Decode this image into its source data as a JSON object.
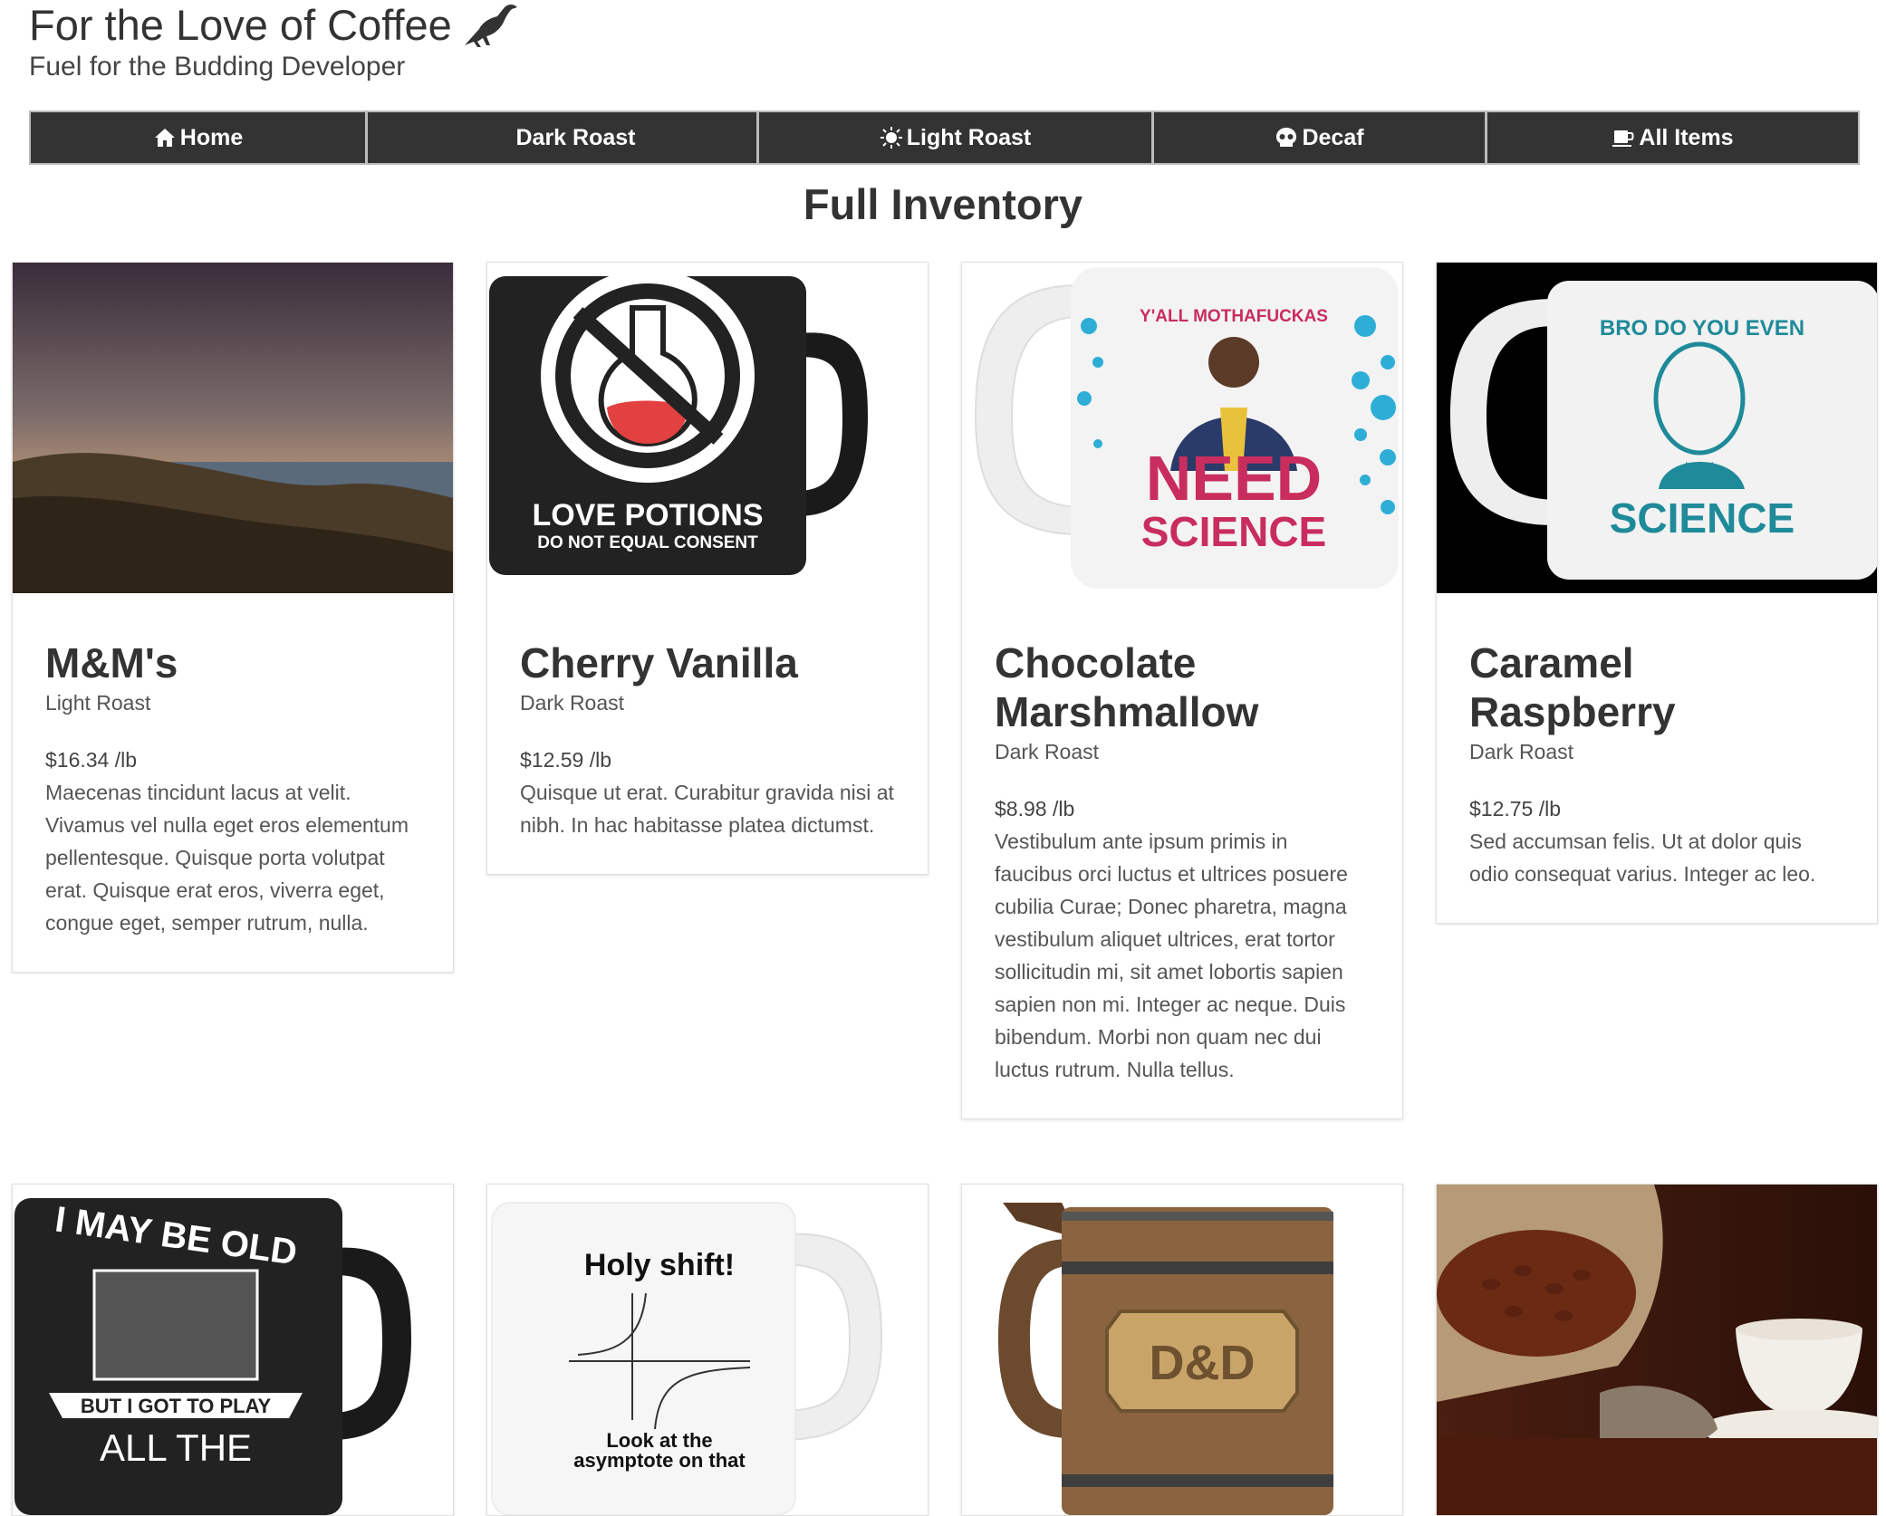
{
  "site": {
    "title": "For the Love of Coffee",
    "subtitle": "Fuel for the Budding Developer"
  },
  "nav": [
    {
      "label": "Home",
      "icon": "home-icon"
    },
    {
      "label": "Dark Roast",
      "icon": "moon-icon"
    },
    {
      "label": "Light Roast",
      "icon": "sun-icon"
    },
    {
      "label": "Decaf",
      "icon": "skull-icon"
    },
    {
      "label": "All Items",
      "icon": "mug-icon"
    }
  ],
  "page_title": "Full Inventory",
  "products": [
    {
      "name": "M&M's",
      "roast": "Light Roast",
      "price": "$16.34 /lb",
      "description": "Maecenas tincidunt lacus at velit. Vivamus vel nulla eget eros elementum pellentesque. Quisque porta volutpat erat. Quisque erat eros, viverra eget, congue eget, semper rutrum, nulla.",
      "image": "landscape-photo"
    },
    {
      "name": "Cherry Vanilla",
      "roast": "Dark Roast",
      "price": "$12.59 /lb",
      "description": "Quisque ut erat. Curabitur gravida nisi at nibh. In hac habitasse platea dictumst.",
      "image": "love-potions-mug",
      "image_text": [
        "LOVE POTIONS",
        "DO NOT EQUAL CONSENT"
      ]
    },
    {
      "name": "Chocolate Marshmallow",
      "roast": "Dark Roast",
      "price": "$8.98 /lb",
      "description": "Vestibulum ante ipsum primis in faucibus orci luctus et ultrices posuere cubilia Curae; Donec pharetra, magna vestibulum aliquet ultrices, erat tortor sollicitudin mi, sit amet lobortis sapien sapien non mi. Integer ac neque. Duis bibendum. Morbi non quam nec dui luctus rutrum. Nulla tellus.",
      "image": "need-science-mug",
      "image_text": [
        "Y'ALL MOTHAFUCKAS",
        "NEED",
        "SCIENCE"
      ]
    },
    {
      "name": "Caramel Raspberry",
      "roast": "Dark Roast",
      "price": "$12.75 /lb",
      "description": "Sed accumsan felis. Ut at dolor quis odio consequat varius. Integer ac leo.",
      "image": "bro-science-mug",
      "image_text": [
        "BRO DO YOU EVEN",
        "SCIENCE"
      ]
    },
    {
      "image": "gamer-mug",
      "image_text": [
        "I MAY BE OLD",
        "BUT I GOT TO PLAY",
        "ALL THE"
      ]
    },
    {
      "image": "holy-shift-mug",
      "image_text": [
        "Holy shift!",
        "Look at the",
        "asymptote on that"
      ]
    },
    {
      "image": "dnd-tankard",
      "image_text": [
        "D&D"
      ]
    },
    {
      "image": "coffee-beans-photo"
    }
  ]
}
